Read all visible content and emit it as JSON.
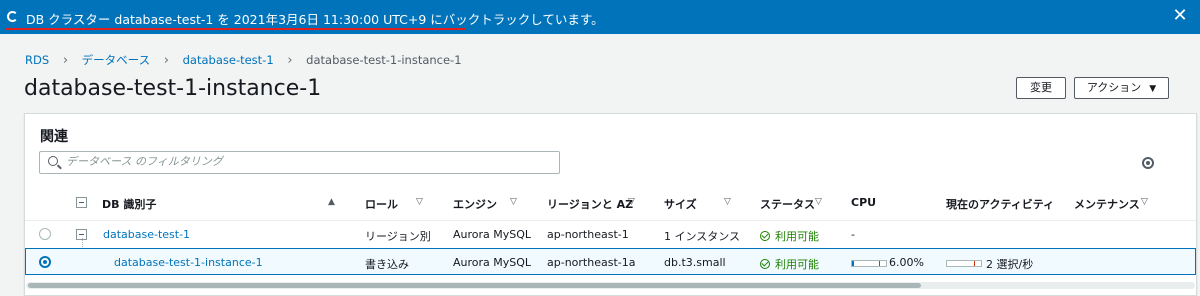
{
  "flash": {
    "message": "DB クラスター database-test-1 を 2021年3月6日 11:30:00 UTC+9 にバックトラックしています。",
    "close_label": "✕",
    "accent": "#0073bb"
  },
  "breadcrumb": {
    "items": [
      "RDS",
      "データベース",
      "database-test-1",
      "database-test-1-instance-1"
    ],
    "separator": "›"
  },
  "page": {
    "title": "database-test-1-instance-1",
    "edit_button": "変更",
    "actions_button": "アクション",
    "actions_caret": "▼"
  },
  "panel": {
    "heading": "関連",
    "filter_placeholder": "データベース のフィルタリング"
  },
  "table": {
    "headers": {
      "id": "DB 識別子",
      "role": "ロール",
      "engine": "エンジン",
      "region": "リージョンと AZ",
      "size": "サイズ",
      "status": "ステータス",
      "cpu": "CPU",
      "activity": "現在のアクティビティ",
      "maintenance": "メンテナンス"
    },
    "sort_asc": "▲",
    "sort_toggle": "▽",
    "rows": [
      {
        "id": "database-test-1",
        "role": "リージョン別",
        "engine": "Aurora MySQL",
        "region": "ap-northeast-1",
        "size": "1 インスタンス",
        "status": "利用可能",
        "cpu": "-",
        "selected": false
      },
      {
        "id": "database-test-1-instance-1",
        "role": "書き込み",
        "engine": "Aurora MySQL",
        "region": "ap-northeast-1a",
        "size": "db.t3.small",
        "status": "利用可能",
        "cpu": "6.00%",
        "cpu_fraction": 0.06,
        "activity": "2 選択/秒",
        "activity_fraction": 0.0,
        "selected": true
      }
    ]
  }
}
